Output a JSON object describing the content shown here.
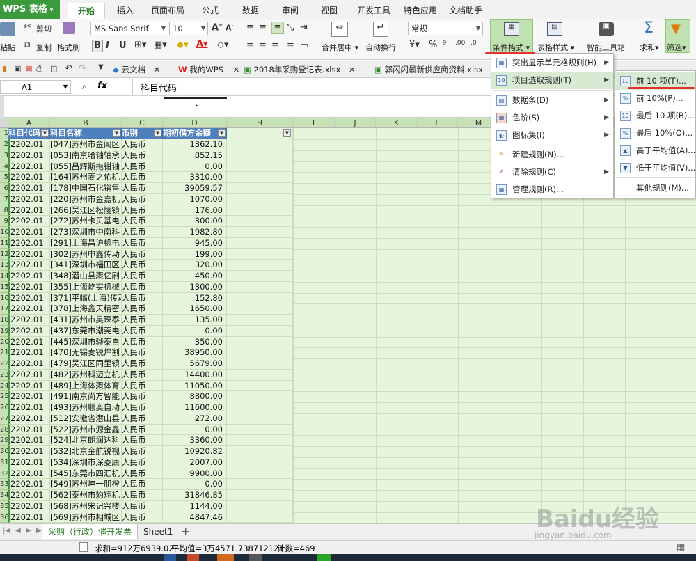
{
  "app": {
    "name": "WPS 表格"
  },
  "ribbon_tabs": [
    "开始",
    "插入",
    "页面布局",
    "公式",
    "数据",
    "审阅",
    "视图",
    "开发工具",
    "特色应用",
    "文档助手"
  ],
  "ribbon": {
    "paste": "粘贴",
    "cut": "剪切",
    "copy": "复制",
    "format_painter": "格式刷",
    "font_name": "MS Sans Serif",
    "font_size": "10",
    "merge_center": "合并居中",
    "wrap_text": "自动换行",
    "number_format": "常规",
    "conditional_format": "条件格式",
    "table_style": "表格样式",
    "smart_toolbox": "智能工具箱",
    "sum": "求和",
    "filter": "筛选"
  },
  "doc_tabs": [
    "云文档",
    "我的WPS",
    "2018年采购登记表.xlsx",
    "郭闪闪最新供应商资料.xlsx"
  ],
  "formula_bar": {
    "cell_ref": "A1",
    "fx": "fx",
    "value": "科目代码"
  },
  "columns": [
    "A",
    "B",
    "C",
    "D",
    "H",
    "I",
    "J",
    "K",
    "L",
    "M"
  ],
  "table_headers": [
    "科目代码",
    "科目名称",
    "币别",
    "期初借方余额"
  ],
  "rows": [
    {
      "n": "2",
      "code": "2202.01",
      "name": "[047]苏州市金阊区",
      "cur": "人民币",
      "amt": "1362.10"
    },
    {
      "n": "3",
      "code": "2202.01",
      "name": "[053]南京哈轴轴承",
      "cur": "人民币",
      "amt": "852.15"
    },
    {
      "n": "4",
      "code": "2202.01",
      "name": "[055]昌辉斯拖钳轴",
      "cur": "人民币",
      "amt": "0.00"
    },
    {
      "n": "5",
      "code": "2202.01",
      "name": "[164]苏州菱之佑机",
      "cur": "人民币",
      "amt": "3310.00"
    },
    {
      "n": "6",
      "code": "2202.01",
      "name": "[178]中国石化销售",
      "cur": "人民币",
      "amt": "39059.57"
    },
    {
      "n": "7",
      "code": "2202.01",
      "name": "[220]苏州市金嘉机",
      "cur": "人民币",
      "amt": "1070.00"
    },
    {
      "n": "8",
      "code": "2202.01",
      "name": "[266]吴江区松陵镇",
      "cur": "人民币",
      "amt": "176.00"
    },
    {
      "n": "9",
      "code": "2202.01",
      "name": "[272]苏州卡贝基电",
      "cur": "人民币",
      "amt": "300.00"
    },
    {
      "n": "10",
      "code": "2202.01",
      "name": "[273]深圳市中南科",
      "cur": "人民币",
      "amt": "1982.80"
    },
    {
      "n": "11",
      "code": "2202.01",
      "name": "[291]上海昌沪机电",
      "cur": "人民币",
      "amt": "945.00"
    },
    {
      "n": "12",
      "code": "2202.01",
      "name": "[302]苏州申鑫传动",
      "cur": "人民币",
      "amt": "199.00"
    },
    {
      "n": "13",
      "code": "2202.01",
      "name": "[341]深圳市福田区",
      "cur": "人民币",
      "amt": "320.00"
    },
    {
      "n": "14",
      "code": "2202.01",
      "name": "[348]潜山县聚亿刷",
      "cur": "人民币",
      "amt": "450.00"
    },
    {
      "n": "15",
      "code": "2202.01",
      "name": "[355]上海屹实机械",
      "cur": "人民币",
      "amt": "1300.00"
    },
    {
      "n": "16",
      "code": "2202.01",
      "name": "[371]平临(上海)传动",
      "cur": "人民币",
      "amt": "152.80"
    },
    {
      "n": "17",
      "code": "2202.01",
      "name": "[378]上海鑫天精密",
      "cur": "人民币",
      "amt": "1650.00"
    },
    {
      "n": "18",
      "code": "2202.01",
      "name": "[431]苏州市昊琛泰",
      "cur": "人民币",
      "amt": "135.00"
    },
    {
      "n": "19",
      "code": "2202.01",
      "name": "[437]东莞市潮莞电",
      "cur": "人民币",
      "amt": "0.00"
    },
    {
      "n": "20",
      "code": "2202.01",
      "name": "[445]深圳市骅泰自",
      "cur": "人民币",
      "amt": "350.00"
    },
    {
      "n": "21",
      "code": "2202.01",
      "name": "[470]无锡麦锐焊割",
      "cur": "人民币",
      "amt": "38950.00"
    },
    {
      "n": "22",
      "code": "2202.01",
      "name": "[479]吴江区同里镇",
      "cur": "人民币",
      "amt": "5679.00"
    },
    {
      "n": "23",
      "code": "2202.01",
      "name": "[482]苏州科迈立机",
      "cur": "人民币",
      "amt": "14400.00"
    },
    {
      "n": "24",
      "code": "2202.01",
      "name": "[489]上海体聚体育",
      "cur": "人民币",
      "amt": "11050.00"
    },
    {
      "n": "25",
      "code": "2202.01",
      "name": "[491]南京尚方智能",
      "cur": "人民币",
      "amt": "8800.00"
    },
    {
      "n": "26",
      "code": "2202.01",
      "name": "[493]苏州顺奥自动",
      "cur": "人民币",
      "amt": "11600.00"
    },
    {
      "n": "27",
      "code": "2202.01",
      "name": "[512]安徽省潜山县",
      "cur": "人民币",
      "amt": "272.00"
    },
    {
      "n": "28",
      "code": "2202.01",
      "name": "[522]苏州市源金鑫",
      "cur": "人民币",
      "amt": "0.00"
    },
    {
      "n": "29",
      "code": "2202.01",
      "name": "[524]北京朗润达科",
      "cur": "人民币",
      "amt": "3360.00"
    },
    {
      "n": "30",
      "code": "2202.01",
      "name": "[532]北京金航锐视",
      "cur": "人民币",
      "amt": "10920.82"
    },
    {
      "n": "31",
      "code": "2202.01",
      "name": "[534]深圳市深菱康",
      "cur": "人民币",
      "amt": "2007.00"
    },
    {
      "n": "32",
      "code": "2202.01",
      "name": "[545]东莞市四汇机",
      "cur": "人民币",
      "amt": "9900.00"
    },
    {
      "n": "33",
      "code": "2202.01",
      "name": "[549]苏州坤一朋橙",
      "cur": "人民币",
      "amt": "0.00"
    },
    {
      "n": "34",
      "code": "2202.01",
      "name": "[562]泰州市豹翔机",
      "cur": "人民币",
      "amt": "31846.85"
    },
    {
      "n": "35",
      "code": "2202.01",
      "name": "[568]苏州宋记兴楼",
      "cur": "人民币",
      "amt": "1144.00"
    },
    {
      "n": "36",
      "code": "2202.01",
      "name": "[569]苏州市相城区",
      "cur": "人民币",
      "amt": "4847.46"
    }
  ],
  "cond_menu": [
    "突出显示单元格规则(H)",
    "项目选取规则(T)",
    "数据条(D)",
    "色阶(S)",
    "图标集(I)",
    "新建规则(N)...",
    "清除规则(C)",
    "管理规则(R)..."
  ],
  "sub_menu": [
    "前 10 项(T)...",
    "前 10%(P)...",
    "最后 10 项(B)...",
    "最后 10%(O)...",
    "高于平均值(A)...",
    "低于平均值(V)...",
    "其他规则(M)..."
  ],
  "sheet_tabs": [
    "采购（行政）催开发票",
    "Sheet1"
  ],
  "status": {
    "sum": "求和=912万6939.02",
    "avg": "平均值=3万4571.738712121",
    "count": "计数=469"
  },
  "watermark": {
    "brand": "Baidu经验",
    "url": "jingyan.baidu.com"
  },
  "colors": {
    "accent_green": "#3b9a3b",
    "header_blue": "#4e7fbd",
    "grid_bg": "#e7f5dc",
    "menu_hover": "#d9ead3",
    "underline_red": "#e53030"
  }
}
